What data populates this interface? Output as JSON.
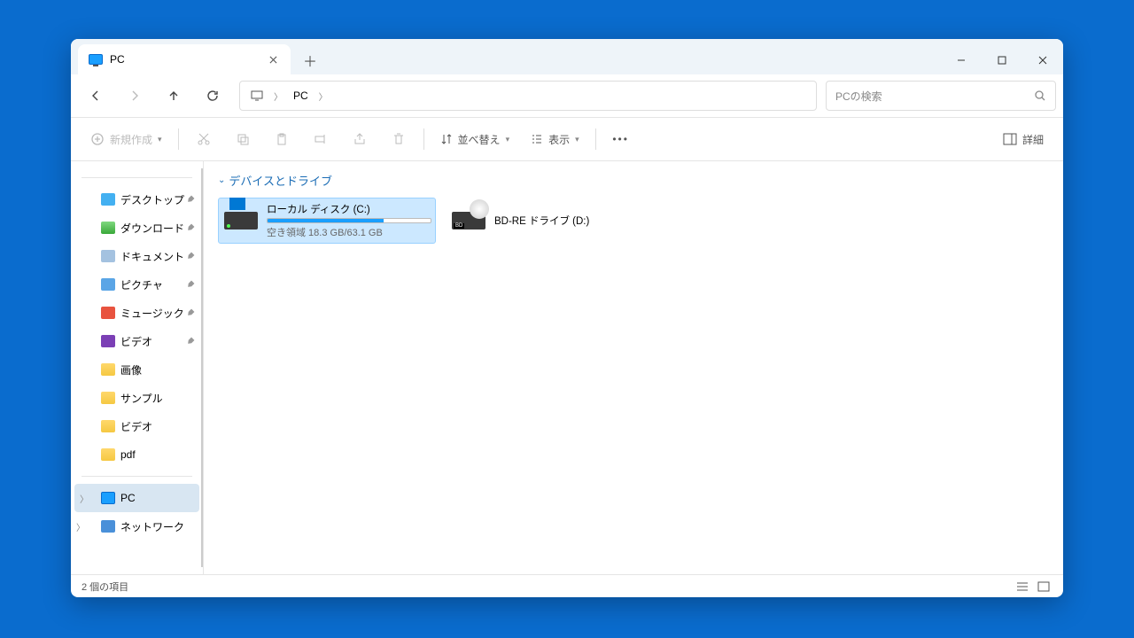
{
  "tab": {
    "title": "PC"
  },
  "breadcrumb": {
    "current": "PC"
  },
  "search": {
    "placeholder": "PCの検索"
  },
  "toolbar": {
    "new_label": "新規作成",
    "sort_label": "並べ替え",
    "view_label": "表示",
    "details_label": "詳細"
  },
  "sidebar": {
    "quick": [
      {
        "label": "デスクトップ",
        "icon": "fi-blue",
        "pinned": true
      },
      {
        "label": "ダウンロード",
        "icon": "fi-green",
        "pinned": true
      },
      {
        "label": "ドキュメント",
        "icon": "fi-doc",
        "pinned": true
      },
      {
        "label": "ピクチャ",
        "icon": "fi-pic",
        "pinned": true
      },
      {
        "label": "ミュージック",
        "icon": "fi-music",
        "pinned": true
      },
      {
        "label": "ビデオ",
        "icon": "fi-video",
        "pinned": true
      },
      {
        "label": "画像",
        "icon": "fi-folder",
        "pinned": false
      },
      {
        "label": "サンプル",
        "icon": "fi-folder",
        "pinned": false
      },
      {
        "label": "ビデオ",
        "icon": "fi-folder",
        "pinned": false
      },
      {
        "label": "pdf",
        "icon": "fi-folder",
        "pinned": false
      }
    ],
    "system": [
      {
        "label": "PC",
        "icon": "fi-pc",
        "active": true,
        "expandable": true
      },
      {
        "label": "ネットワーク",
        "icon": "fi-net",
        "active": false,
        "expandable": true
      }
    ]
  },
  "content": {
    "section_title": "デバイスとドライブ",
    "drives": [
      {
        "name": "ローカル ディスク (C:)",
        "free_text": "空き領域 18.3 GB/63.1 GB",
        "fill_pct": 71,
        "type": "hdd",
        "selected": true
      },
      {
        "name": "BD-RE ドライブ (D:)",
        "type": "bd",
        "selected": false
      }
    ]
  },
  "status": {
    "count_text": "2 個の項目"
  }
}
